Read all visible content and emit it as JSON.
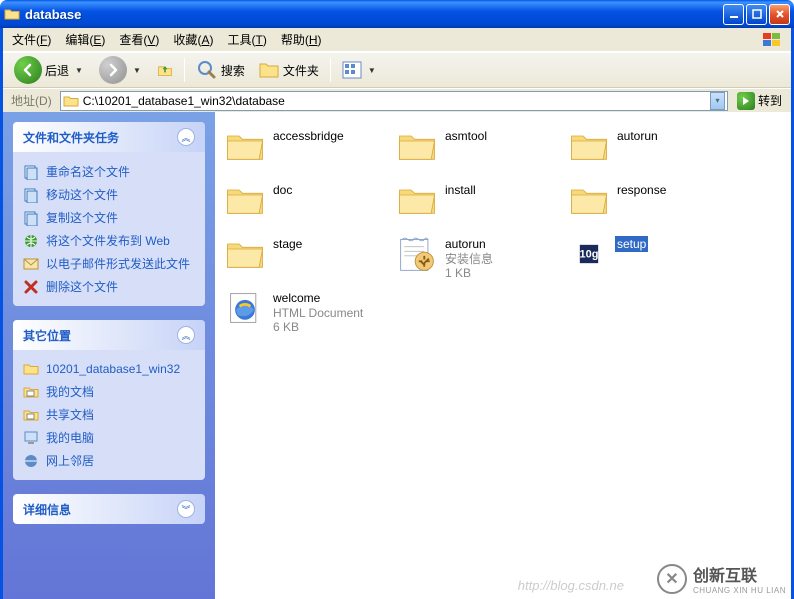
{
  "window": {
    "title": "database"
  },
  "menu": {
    "items": [
      {
        "label": "文件",
        "ul": "F"
      },
      {
        "label": "编辑",
        "ul": "E"
      },
      {
        "label": "查看",
        "ul": "V"
      },
      {
        "label": "收藏",
        "ul": "A"
      },
      {
        "label": "工具",
        "ul": "T"
      },
      {
        "label": "帮助",
        "ul": "H"
      }
    ]
  },
  "toolbar": {
    "back": "后退",
    "search": "搜索",
    "folders": "文件夹"
  },
  "address": {
    "label": "地址",
    "ul": "D",
    "value": "C:\\10201_database1_win32\\database",
    "go": "转到"
  },
  "sidebar": {
    "tasks_title": "文件和文件夹任务",
    "tasks": [
      {
        "label": "重命名这个文件",
        "icon": "rename"
      },
      {
        "label": "移动这个文件",
        "icon": "move"
      },
      {
        "label": "复制这个文件",
        "icon": "copy"
      },
      {
        "label": "将这个文件发布到 Web",
        "icon": "publish"
      },
      {
        "label": "以电子邮件形式发送此文件",
        "icon": "email"
      },
      {
        "label": "删除这个文件",
        "icon": "delete"
      }
    ],
    "places_title": "其它位置",
    "places": [
      {
        "label": "10201_database1_win32",
        "icon": "folder"
      },
      {
        "label": "我的文档",
        "icon": "mydocs"
      },
      {
        "label": "共享文档",
        "icon": "shared"
      },
      {
        "label": "我的电脑",
        "icon": "mycomputer"
      },
      {
        "label": "网上邻居",
        "icon": "network"
      }
    ],
    "details_title": "详细信息"
  },
  "files": [
    {
      "name": "accessbridge",
      "type": "folder"
    },
    {
      "name": "asmtool",
      "type": "folder"
    },
    {
      "name": "autorun",
      "type": "folder"
    },
    {
      "name": "doc",
      "type": "folder"
    },
    {
      "name": "install",
      "type": "folder"
    },
    {
      "name": "response",
      "type": "folder"
    },
    {
      "name": "stage",
      "type": "folder"
    },
    {
      "name": "autorun",
      "type": "inf",
      "sub1": "安装信息",
      "sub2": "1 KB"
    },
    {
      "name": "setup",
      "type": "exe",
      "selected": true
    },
    {
      "name": "welcome",
      "type": "html",
      "sub1": "HTML Document",
      "sub2": "6 KB"
    }
  ],
  "watermark": {
    "text1": "创新互联",
    "text2": "CHUANG XIN HU LIAN",
    "url": "http://blog.csdn.ne"
  }
}
